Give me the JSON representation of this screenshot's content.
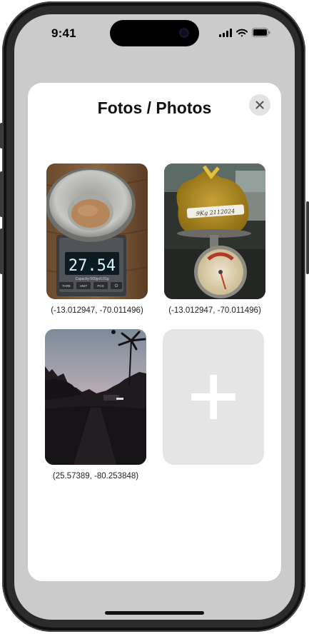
{
  "status_bar": {
    "time": "9:41"
  },
  "modal": {
    "title": "Fotos / Photos",
    "photos": [
      {
        "coordinates": "(-13.012947, -70.011496)",
        "display_reading": "27.54",
        "scale_buttons": [
          "TARE",
          "UNIT",
          "PCS",
          "⏻"
        ],
        "scale_caption": "Capacity:500gx0.01g"
      },
      {
        "coordinates": "(-13.012947, -70.011496)",
        "bag_label": "9Kg 2112024"
      },
      {
        "coordinates": "(25.57389, -80.253848)"
      }
    ]
  },
  "icons": {
    "close": "close-icon",
    "add": "plus-icon",
    "signal": "cellular-signal-icon",
    "wifi": "wifi-icon",
    "battery": "battery-icon"
  },
  "colors": {
    "screen_background": "#cbcbcb",
    "modal_background": "#ffffff",
    "add_tile": "#e5e5e5",
    "plus": "#ffffff",
    "close_button": "#e3e3e3"
  }
}
